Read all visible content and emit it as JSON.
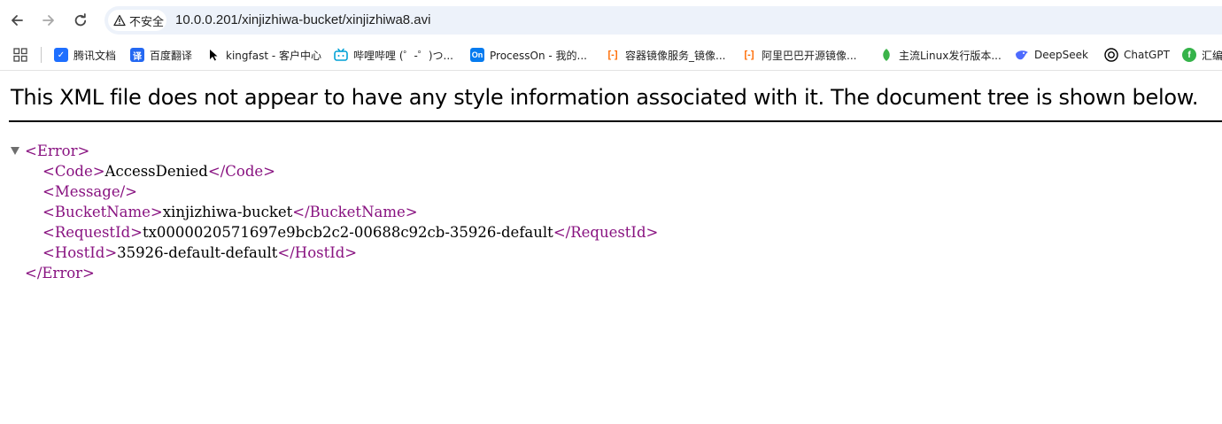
{
  "browser": {
    "security_chip_label": "不安全",
    "url": "10.0.0.201/xinjizhiwa-bucket/xinjizhiwa8.avi"
  },
  "bookmarks": [
    {
      "label": "腾讯文档",
      "icon": "tencent-docs-icon",
      "color": "#1e6fff"
    },
    {
      "label": "百度翻译",
      "icon": "baidu-translate-icon",
      "color": "#2468f2"
    },
    {
      "label": "kingfast - 客户中心",
      "icon": "cursor-icon",
      "color": "#000000"
    },
    {
      "label": "哔哩哔哩 (゜-゜)つ...",
      "icon": "bilibili-icon",
      "color": "#00a1d6"
    },
    {
      "label": "ProcessOn - 我的...",
      "icon": "processon-icon",
      "color": "#067bef"
    },
    {
      "label": "容器镜像服务_镜像...",
      "icon": "aliyun-icon",
      "color": "#ff6a00"
    },
    {
      "label": "阿里巴巴开源镜像...",
      "icon": "aliyun-icon",
      "color": "#ff6a00"
    },
    {
      "label": "主流Linux发行版本...",
      "icon": "leaf-icon",
      "color": "#3cb44a"
    },
    {
      "label": "DeepSeek",
      "icon": "deepseek-icon",
      "color": "#4d6bfe"
    },
    {
      "label": "ChatGPT",
      "icon": "chatgpt-icon",
      "color": "#000000"
    },
    {
      "label": "汇编",
      "icon": "green-circle-icon",
      "color": "#35b34a"
    }
  ],
  "page": {
    "info_message": "This XML file does not appear to have any style information associated with it. The document tree is shown below.",
    "xml": {
      "root_open": "<Error>",
      "root_close": "</Error>",
      "code_open": "<Code>",
      "code_value": "AccessDenied",
      "code_close": "</Code>",
      "message_self": "<Message/>",
      "bucket_open": "<BucketName>",
      "bucket_value": "xinjizhiwa-bucket",
      "bucket_close": "</BucketName>",
      "requestid_open": "<RequestId>",
      "requestid_value": "tx0000020571697e9bcb2c2-00688c92cb-35926-default",
      "requestid_close": "</RequestId>",
      "hostid_open": "<HostId>",
      "hostid_value": "35926-default-default",
      "hostid_close": "</HostId>"
    }
  }
}
